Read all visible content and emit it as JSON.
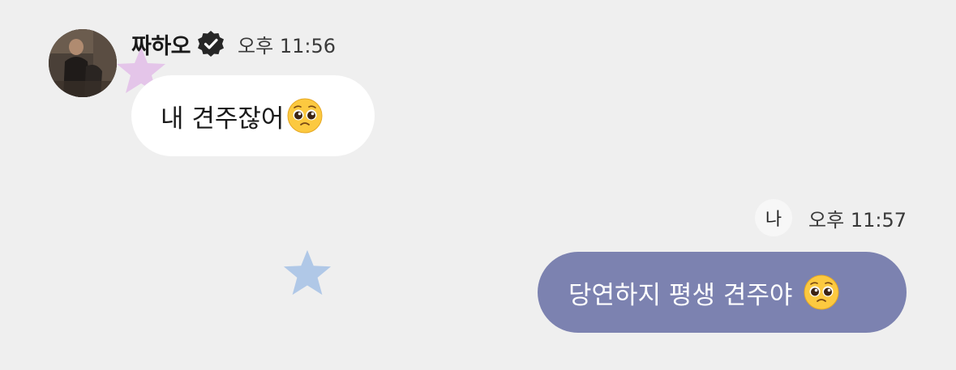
{
  "thread": {
    "incoming": {
      "sender_name": "짜하오",
      "verified": true,
      "time": "오후 11:56",
      "message": "내 견주잖어",
      "emoji": "pleading-face"
    },
    "outgoing": {
      "me_label": "나",
      "time": "오후 11:57",
      "message": "당연하지 평생 견주야",
      "emoji": "pleading-face"
    }
  },
  "decorations": {
    "stars": [
      {
        "name": "pink-star",
        "color": "#e2bde8"
      },
      {
        "name": "blue-star",
        "color": "#a9c3e6"
      }
    ]
  },
  "colors": {
    "background": "#efefef",
    "incoming_bubble": "#ffffff",
    "outgoing_bubble": "#7c82b0",
    "outgoing_text": "#ffffff"
  }
}
